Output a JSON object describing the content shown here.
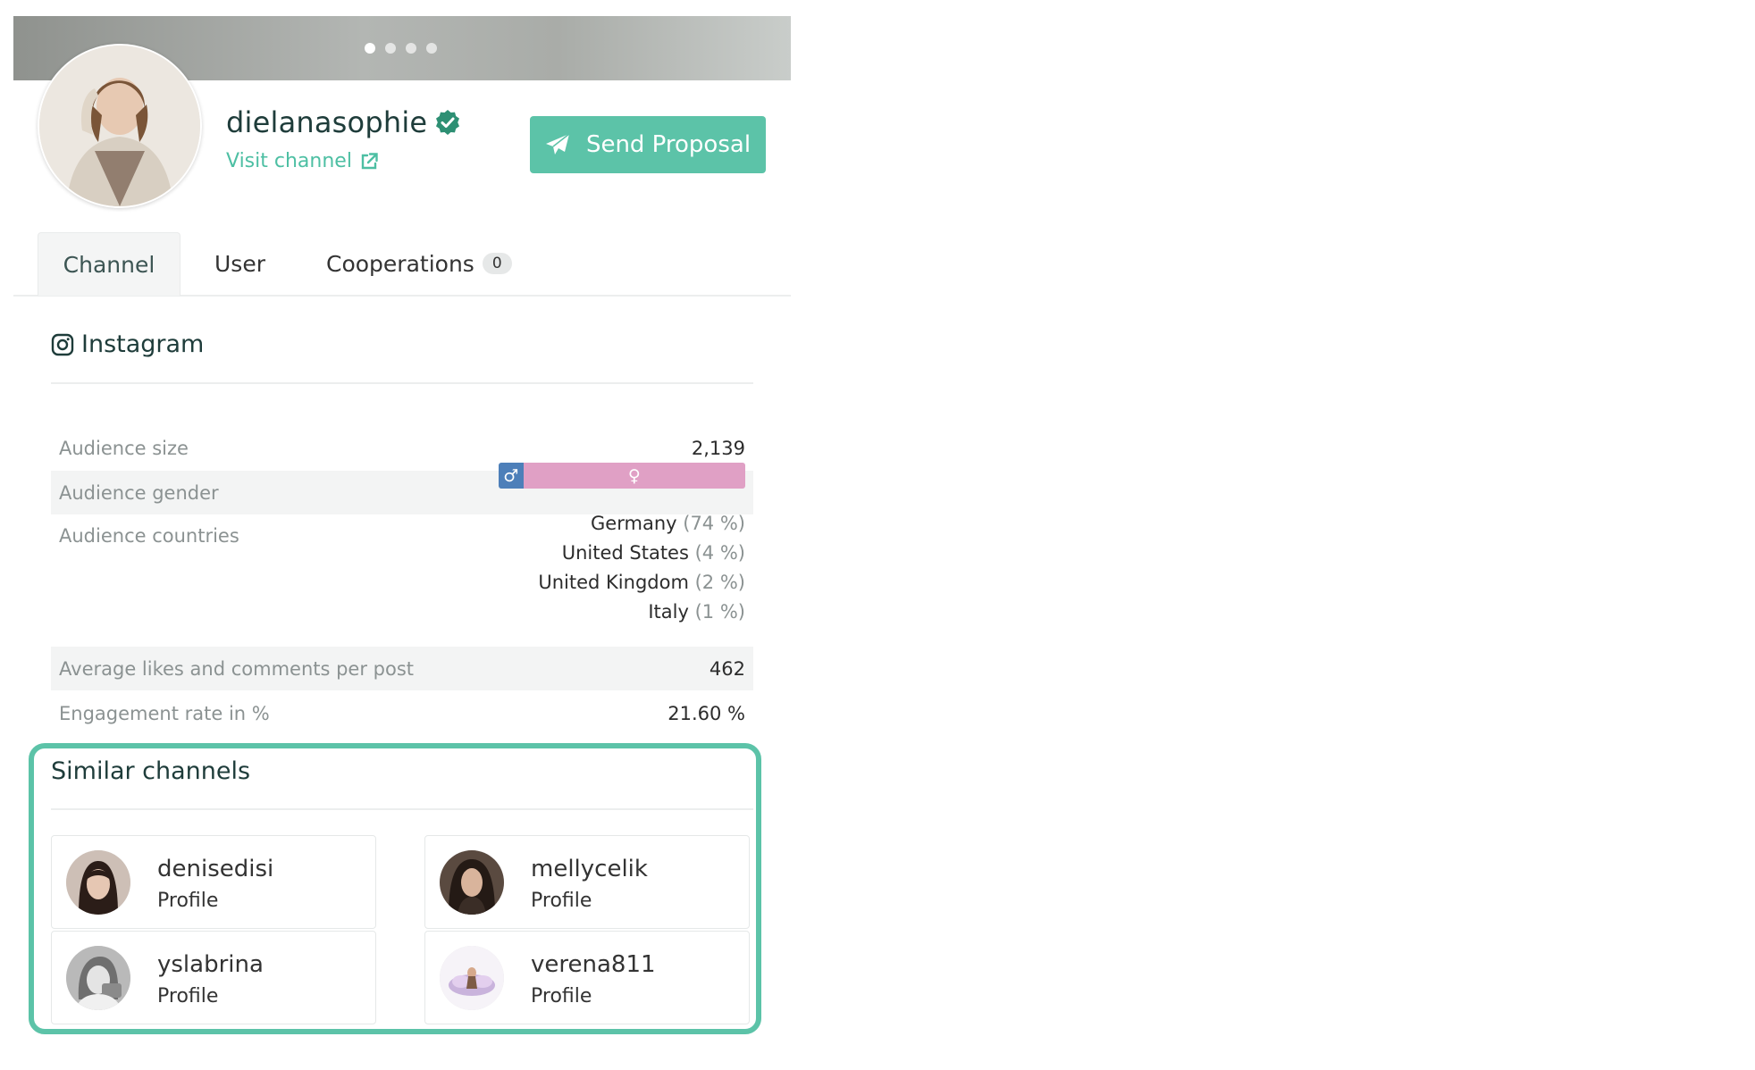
{
  "profile": {
    "name": "dielanasophie",
    "visit_label": "Visit channel",
    "send_label": "Send Proposal"
  },
  "tabs": [
    {
      "label": "Channel"
    },
    {
      "label": "User"
    },
    {
      "label": "Cooperations",
      "count": "0"
    }
  ],
  "platform": {
    "name": "Instagram"
  },
  "stats": {
    "audience_size": {
      "label": "Audience size",
      "value": "2,139"
    },
    "audience_gender": {
      "label": "Audience gender",
      "male_share": 0.1,
      "female_share": 0.9
    },
    "audience_countries": {
      "label": "Audience countries",
      "items": [
        {
          "name": "Germany",
          "pct": "(74 %)"
        },
        {
          "name": "United States",
          "pct": "(4 %)"
        },
        {
          "name": "United Kingdom",
          "pct": "(2 %)"
        },
        {
          "name": "Italy",
          "pct": "(1 %)"
        }
      ]
    },
    "avg_likes": {
      "label": "Average likes and comments per post",
      "value": "462"
    },
    "engagement": {
      "label": "Engagement rate in %",
      "value": "21.60 %"
    }
  },
  "similar": {
    "title": "Similar channels",
    "channels": [
      {
        "name": "denisedisi",
        "sub": "Profile"
      },
      {
        "name": "mellycelik",
        "sub": "Profile"
      },
      {
        "name": "yslabrina",
        "sub": "Profile"
      },
      {
        "name": "verena811",
        "sub": "Profile"
      }
    ]
  },
  "colors": {
    "accent": "#5cc3a8",
    "link": "#4dbfa3",
    "male": "#4d7fb9",
    "female": "#e0a0c5"
  },
  "icons": {
    "verified": "verified-check-icon",
    "external": "external-link-icon",
    "send": "paper-plane-icon",
    "platform": "instagram-icon",
    "male": "male-symbol-icon",
    "female": "female-symbol-icon"
  }
}
